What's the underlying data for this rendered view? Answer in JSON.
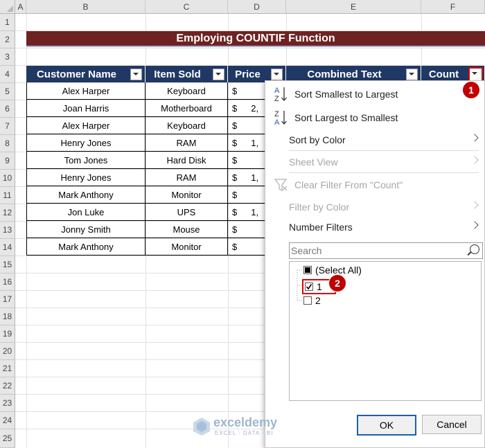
{
  "columns": [
    "A",
    "B",
    "C",
    "D",
    "E",
    "F"
  ],
  "rows": [
    "1",
    "2",
    "3",
    "4",
    "5",
    "6",
    "7",
    "8",
    "9",
    "10",
    "11",
    "12",
    "13",
    "14",
    "15",
    "16",
    "17",
    "18",
    "19",
    "20",
    "21",
    "22",
    "23",
    "24",
    "25"
  ],
  "title": "Employing COUNTIF Function",
  "table": {
    "headers": [
      "Customer Name",
      "Item Sold",
      "Price",
      "Combined Text",
      "Count"
    ],
    "names": [
      "Alex Harper",
      "Joan Harris",
      "Alex Harper",
      "Henry Jones",
      "Tom Jones",
      "Henry Jones",
      "Mark Anthony",
      "Jon Luke",
      "Jonny Smith",
      "Mark Anthony"
    ],
    "items": [
      "Keyboard",
      "Motherboard",
      "Keyboard",
      "RAM",
      "Hard Disk",
      "RAM",
      "Monitor",
      "UPS",
      "Mouse",
      "Monitor"
    ],
    "price_prefix": [
      "$",
      "$",
      "$",
      "$",
      "$",
      "$",
      "$",
      "$",
      "$",
      "$"
    ],
    "price_visible": [
      "",
      "2,",
      "",
      "1,",
      "",
      "1,",
      "",
      "1,",
      "",
      ""
    ]
  },
  "menu": {
    "sort_asc": "Sort Smallest to Largest",
    "sort_desc": "Sort Largest to Smallest",
    "sort_color": "Sort by Color",
    "sheet_view": "Sheet View",
    "clear_filter": "Clear Filter From \"Count\"",
    "filter_color": "Filter by Color",
    "number_filters": "Number Filters",
    "search_placeholder": "Search",
    "list": [
      "(Select All)",
      "1",
      "2"
    ],
    "ok": "OK",
    "cancel": "Cancel",
    "sort_icon_az_top": "A",
    "sort_icon_az_bottom": "Z",
    "sort_icon_za_top": "Z",
    "sort_icon_za_bottom": "A"
  },
  "badges": [
    "1",
    "2"
  ],
  "watermark": {
    "name": "exceldemy",
    "tagline": "EXCEL · DATA · BI"
  },
  "colors": {
    "title_bg": "#6f2222",
    "header_bg": "#203864",
    "badge": "#c00000"
  }
}
